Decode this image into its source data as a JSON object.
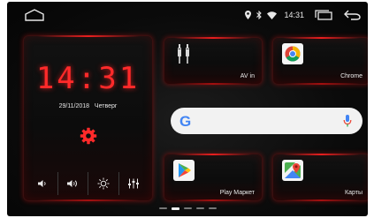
{
  "status": {
    "time": "14:31",
    "icons": [
      "location-icon",
      "bluetooth-icon",
      "wifi-icon"
    ]
  },
  "clock_widget": {
    "time": "14:31",
    "date": "29/11/2018",
    "weekday": "Четверг",
    "controls": [
      "volume-down-icon",
      "volume-up-icon",
      "brightness-icon",
      "equalizer-icon"
    ]
  },
  "apps": {
    "av_in": "AV in",
    "chrome": "Chrome",
    "play_market": "Play Маркет",
    "maps": "Карты"
  },
  "search": {
    "logo": "G"
  },
  "pager": {
    "pages": 5,
    "active_index": 1
  },
  "colors": {
    "accent_red": "#ff2a2a",
    "background": "#0b0b0b",
    "search_bg": "#f2f2f2"
  }
}
